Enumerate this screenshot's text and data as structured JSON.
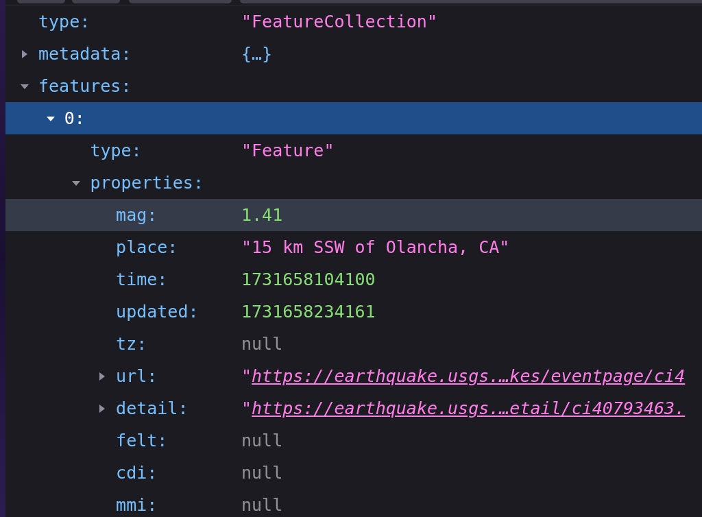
{
  "rows": [
    {
      "key": "type:",
      "kind": "string",
      "value": "\"FeatureCollection\"",
      "selected": false,
      "hovered": false
    },
    {
      "key": "metadata:",
      "kind": "object",
      "value": "{…}",
      "expanded": false,
      "selected": false,
      "hovered": false
    },
    {
      "key": "features:",
      "expanded": true,
      "selected": false,
      "hovered": false,
      "children": [
        {
          "key": "0:",
          "expanded": true,
          "selected": true,
          "hovered": false,
          "children": [
            {
              "key": "type:",
              "kind": "string",
              "value": "\"Feature\"",
              "selected": false,
              "hovered": false
            },
            {
              "key": "properties:",
              "expanded": true,
              "selected": false,
              "hovered": false,
              "children": [
                {
                  "key": "mag:",
                  "kind": "number",
                  "value": "1.41",
                  "selected": false,
                  "hovered": true
                },
                {
                  "key": "place:",
                  "kind": "string",
                  "value": "\"15 km SSW of Olancha, CA\"",
                  "selected": false,
                  "hovered": false
                },
                {
                  "key": "time:",
                  "kind": "number",
                  "value": "1731658104100",
                  "selected": false,
                  "hovered": false
                },
                {
                  "key": "updated:",
                  "kind": "number",
                  "value": "1731658234161",
                  "selected": false,
                  "hovered": false
                },
                {
                  "key": "tz:",
                  "kind": "null",
                  "value": "null",
                  "selected": false,
                  "hovered": false
                },
                {
                  "key": "url:",
                  "kind": "link",
                  "quote": "\"",
                  "value": "https://earthquake.usgs.…kes/eventpage/ci4",
                  "expanded": false,
                  "selected": false,
                  "hovered": false
                },
                {
                  "key": "detail:",
                  "kind": "link",
                  "quote": "\"",
                  "value": "https://earthquake.usgs.…etail/ci40793463.",
                  "expanded": false,
                  "selected": false,
                  "hovered": false
                },
                {
                  "key": "felt:",
                  "kind": "null",
                  "value": "null",
                  "selected": false,
                  "hovered": false
                },
                {
                  "key": "cdi:",
                  "kind": "null",
                  "value": "null",
                  "selected": false,
                  "hovered": false
                },
                {
                  "key": "mmi:",
                  "kind": "null",
                  "value": "null",
                  "selected": false,
                  "hovered": false
                }
              ]
            }
          ]
        }
      ]
    }
  ]
}
